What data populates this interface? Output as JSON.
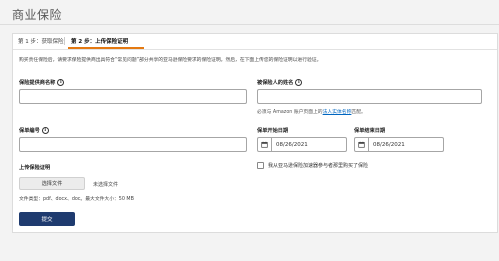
{
  "page": {
    "title": "商业保险"
  },
  "tabs": [
    {
      "label": "第 1 步：获取保险",
      "active": false
    },
    {
      "label": "第 2 步：上传保险证明",
      "active": true
    }
  ],
  "form": {
    "intro": "购买责任保险后，请要求保险提供商出具符合“常见问题”部分共享的亚马逊保险要求的保险证明。然后，在下面上传您的保险证明以进行验证。",
    "provider_label": "保险提供商名称",
    "provider_value": "",
    "insured_label": "被保险人的姓名",
    "insured_value": "",
    "insured_hint_prefix": "必须与 Amazon 账户页面上的",
    "insured_hint_link": "法人实体名称",
    "insured_hint_suffix": "匹配。",
    "policy_label": "保单编号",
    "policy_value": "",
    "start_label": "保单开始日期",
    "start_value": "08/26/2021",
    "end_label": "保单结束日期",
    "end_value": "08/26/2021",
    "upload_label": "上传保险证明",
    "choose_file_label": "选择文件",
    "no_file_text": "未选择文件",
    "file_types_text": "文件类型：pdf、docx、doc。最大文件大小：50 MB",
    "checkbox_label": "我从亚马逊保险加速器参与者那里购买了保险",
    "submit_label": "提交"
  },
  "icons": {
    "info": "info-icon",
    "calendar": "calendar-icon"
  },
  "colors": {
    "tab_accent": "#e47911",
    "submit_bg": "#1f3b6f",
    "link": "#0066c0"
  }
}
